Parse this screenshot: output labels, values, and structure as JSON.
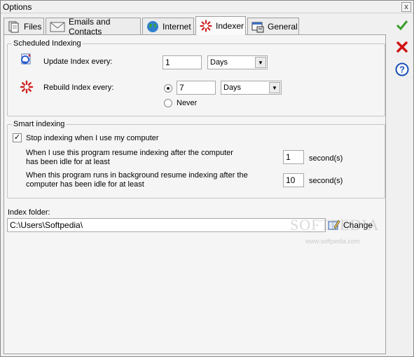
{
  "window": {
    "title": "Options",
    "close_glyph": "x"
  },
  "tabs": [
    {
      "label": "Files",
      "icon": "files-icon"
    },
    {
      "label": "Emails and Contacts",
      "icon": "envelope-icon"
    },
    {
      "label": "Internet",
      "icon": "globe-icon"
    },
    {
      "label": "Indexer",
      "icon": "indexer-spinner-icon",
      "active": true
    },
    {
      "label": "General",
      "icon": "general-settings-icon"
    }
  ],
  "scheduled": {
    "legend": "Scheduled Indexing",
    "update_label": "Update Index every:",
    "update_value": "1",
    "update_unit": "Days",
    "rebuild_label": "Rebuild Index every:",
    "rebuild_value": "7",
    "rebuild_unit": "Days",
    "never_label": "Never",
    "rebuild_mode": "interval"
  },
  "smart": {
    "legend": "Smart indexing",
    "stop_label": "Stop indexing when I use my computer",
    "stop_checked": true,
    "resume_fg_label_1": "When I use this program resume indexing after the computer",
    "resume_fg_label_2": "has been idle for at least",
    "resume_fg_value": "1",
    "resume_fg_unit": "second(s)",
    "resume_bg_label_1": "When this program runs in background resume indexing after the",
    "resume_bg_label_2": "computer has been idle for at least",
    "resume_bg_value": "10",
    "resume_bg_unit": "second(s)"
  },
  "folder": {
    "label": "Index folder:",
    "path": "C:\\Users\\Softpedia\\",
    "change_label": "Change"
  },
  "side_actions": [
    {
      "name": "ok",
      "icon": "checkmark-icon"
    },
    {
      "name": "cancel",
      "icon": "red-x-icon"
    },
    {
      "name": "help",
      "icon": "help-icon"
    }
  ],
  "watermark": {
    "text": "SOFTPEDIA",
    "url": "www.softpedia.com"
  },
  "colors": {
    "ok": "#3aa02a",
    "cancel": "#d01010",
    "help": "#1a4fb8",
    "accent": "#d02020"
  }
}
